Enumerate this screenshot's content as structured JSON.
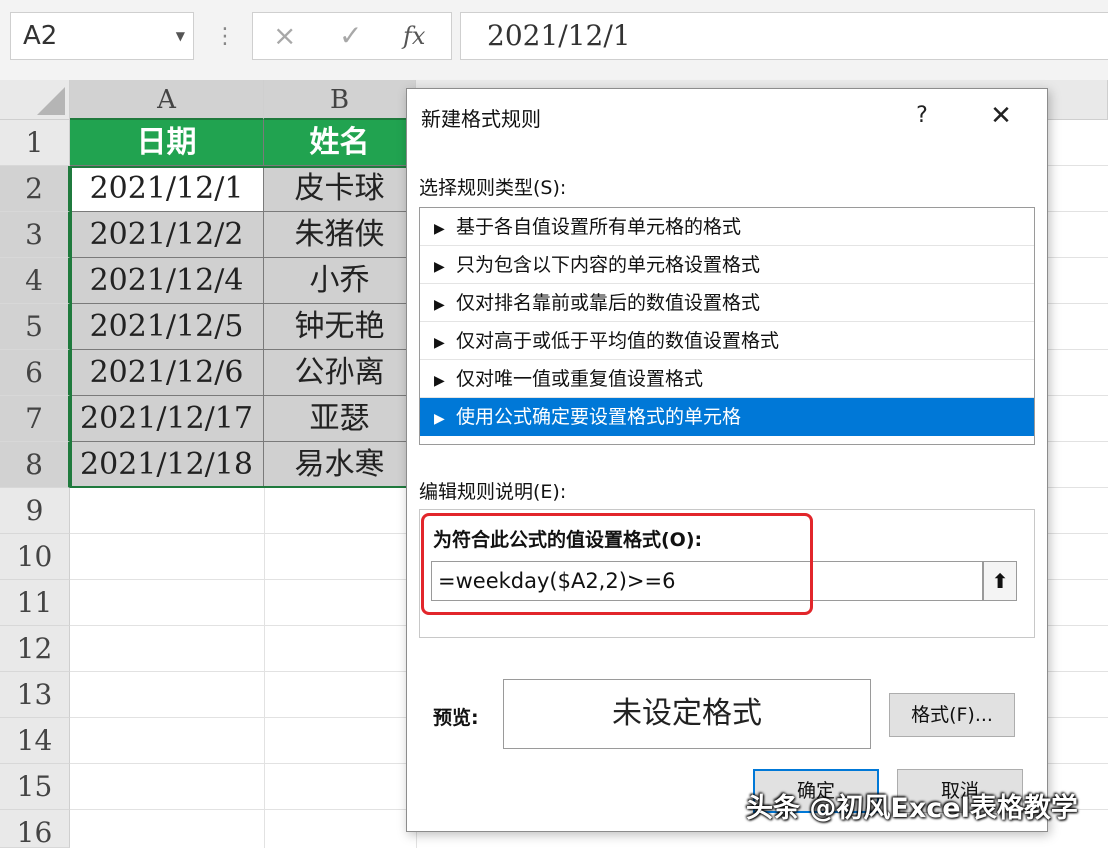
{
  "formula_bar": {
    "name_box": "A2",
    "cancel_icon": "×",
    "enter_icon": "✓",
    "fx_icon": "fx",
    "value": "2021/12/1"
  },
  "sheet": {
    "columns": [
      "A",
      "B"
    ],
    "rows": [
      "1",
      "2",
      "3",
      "4",
      "5",
      "6",
      "7",
      "8",
      "9",
      "10",
      "11",
      "12",
      "13",
      "14",
      "15",
      "16"
    ],
    "headers": {
      "a": "日期",
      "b": "姓名"
    },
    "data": [
      {
        "date": "2021/12/1",
        "name": "皮卡球"
      },
      {
        "date": "2021/12/2",
        "name": "朱猪侠"
      },
      {
        "date": "2021/12/4",
        "name": "小乔"
      },
      {
        "date": "2021/12/5",
        "name": "钟无艳"
      },
      {
        "date": "2021/12/6",
        "name": "公孙离"
      },
      {
        "date": "2021/12/17",
        "name": "亚瑟"
      },
      {
        "date": "2021/12/18",
        "name": "易水寒"
      }
    ],
    "colors": {
      "header_fill": "#21a350",
      "selection": "#1f7a3d",
      "data_fill": "#d0d0d0"
    }
  },
  "dialog": {
    "title": "新建格式规则",
    "help": "?",
    "close": "✕",
    "select_label": "选择规则类型(S):",
    "rule_types": [
      "基于各自值设置所有单元格的格式",
      "只为包含以下内容的单元格设置格式",
      "仅对排名靠前或靠后的数值设置格式",
      "仅对高于或低于平均值的数值设置格式",
      "仅对唯一值或重复值设置格式",
      "使用公式确定要设置格式的单元格"
    ],
    "selected_rule_index": 5,
    "edit_label": "编辑规则说明(E):",
    "formula_label": "为符合此公式的值设置格式(O):",
    "formula_value": "=weekday($A2,2)>=6",
    "collapse_icon": "⬆",
    "preview_label": "预览:",
    "preview_text": "未设定格式",
    "format_button": "格式(F)...",
    "ok_button": "确定",
    "cancel_button": "取消",
    "colors": {
      "selected_rule": "#0078d7",
      "highlight_frame": "#e2262b"
    }
  },
  "watermark": "头条 @初风Excel表格教学"
}
